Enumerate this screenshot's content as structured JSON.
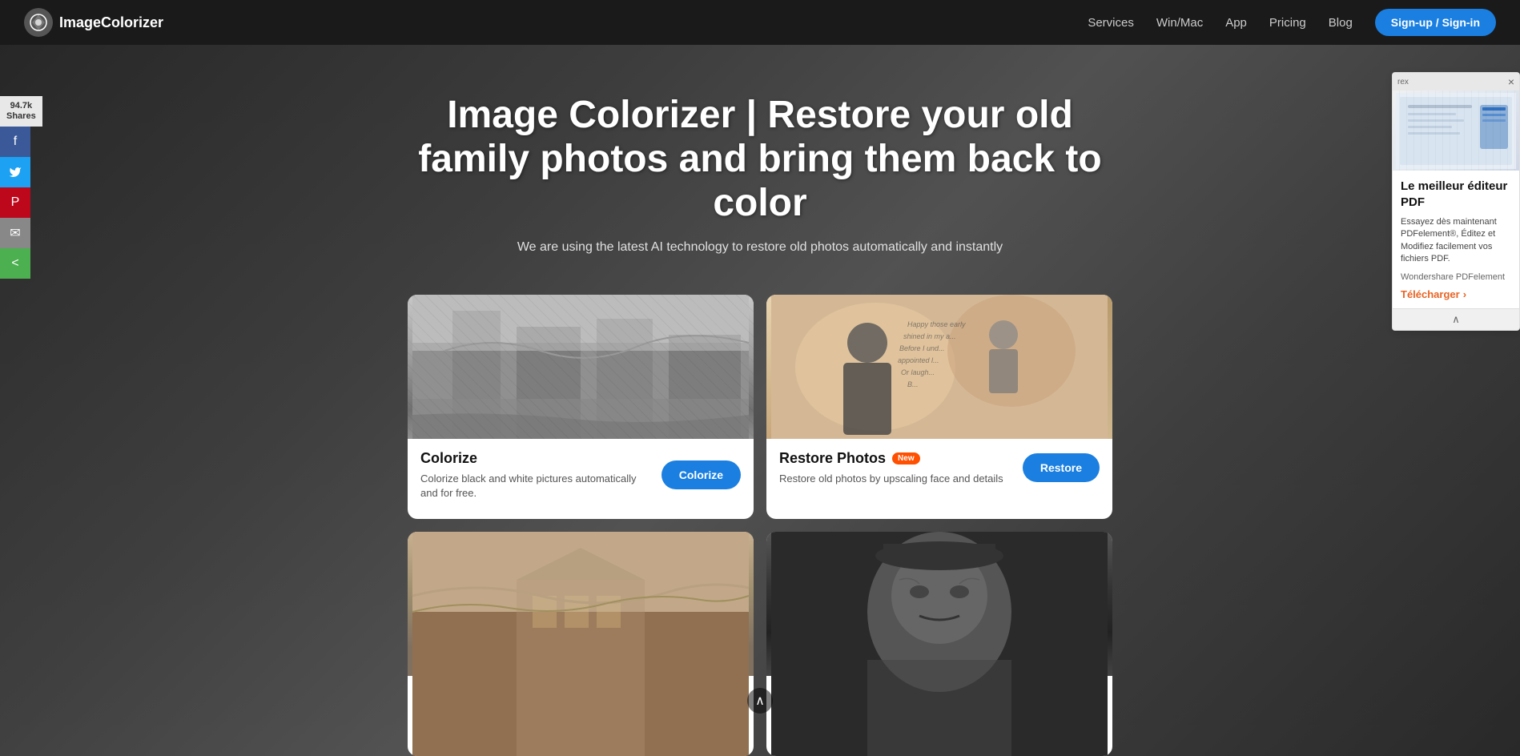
{
  "brand": {
    "name": "ImageColorizer",
    "logo_symbol": "🎨"
  },
  "navbar": {
    "links": [
      {
        "label": "Services",
        "href": "#"
      },
      {
        "label": "Win/Mac",
        "href": "#"
      },
      {
        "label": "App",
        "href": "#"
      },
      {
        "label": "Pricing",
        "href": "#"
      },
      {
        "label": "Blog",
        "href": "#"
      }
    ],
    "cta_label": "Sign-up / Sign-in"
  },
  "hero": {
    "title": "Image Colorizer | Restore your old family photos and bring them back to color",
    "subtitle": "We are using the latest AI technology to restore old photos automatically and instantly"
  },
  "cards": [
    {
      "id": "colorize",
      "title": "Colorize",
      "badge": null,
      "description": "Colorize black and white pictures automatically and for free.",
      "btn_label": "Colorize",
      "image_type": "colorize"
    },
    {
      "id": "restore",
      "title": "Restore Photos",
      "badge": "New",
      "description": "Restore old photos by upscaling face and details",
      "btn_label": "Restore",
      "image_type": "restore"
    },
    {
      "id": "card3",
      "title": "",
      "badge": null,
      "description": "",
      "btn_label": "",
      "image_type": "sepia"
    },
    {
      "id": "card4",
      "title": "",
      "badge": null,
      "description": "",
      "btn_label": "",
      "image_type": "bw"
    }
  ],
  "social": {
    "share_count": "94.7k",
    "shares_label": "Shares",
    "buttons": [
      {
        "name": "facebook",
        "symbol": "f",
        "class": "social-facebook"
      },
      {
        "name": "twitter",
        "symbol": "🐦",
        "class": "social-twitter"
      },
      {
        "name": "pinterest",
        "symbol": "P",
        "class": "social-pinterest"
      },
      {
        "name": "email",
        "symbol": "✉",
        "class": "social-email"
      },
      {
        "name": "share",
        "symbol": "<",
        "class": "social-share"
      }
    ]
  },
  "ad": {
    "header_label": "rex",
    "title": "Le meilleur éditeur PDF",
    "description": "Essayez dès maintenant PDFelement®, Éditez et Modifiez facilement vos fichiers PDF.",
    "brand": "Wondershare PDFelement",
    "cta_label": "Télécharger",
    "close_symbol": "×",
    "collapse_symbol": "∧"
  },
  "scroll": {
    "symbol": "∧"
  }
}
